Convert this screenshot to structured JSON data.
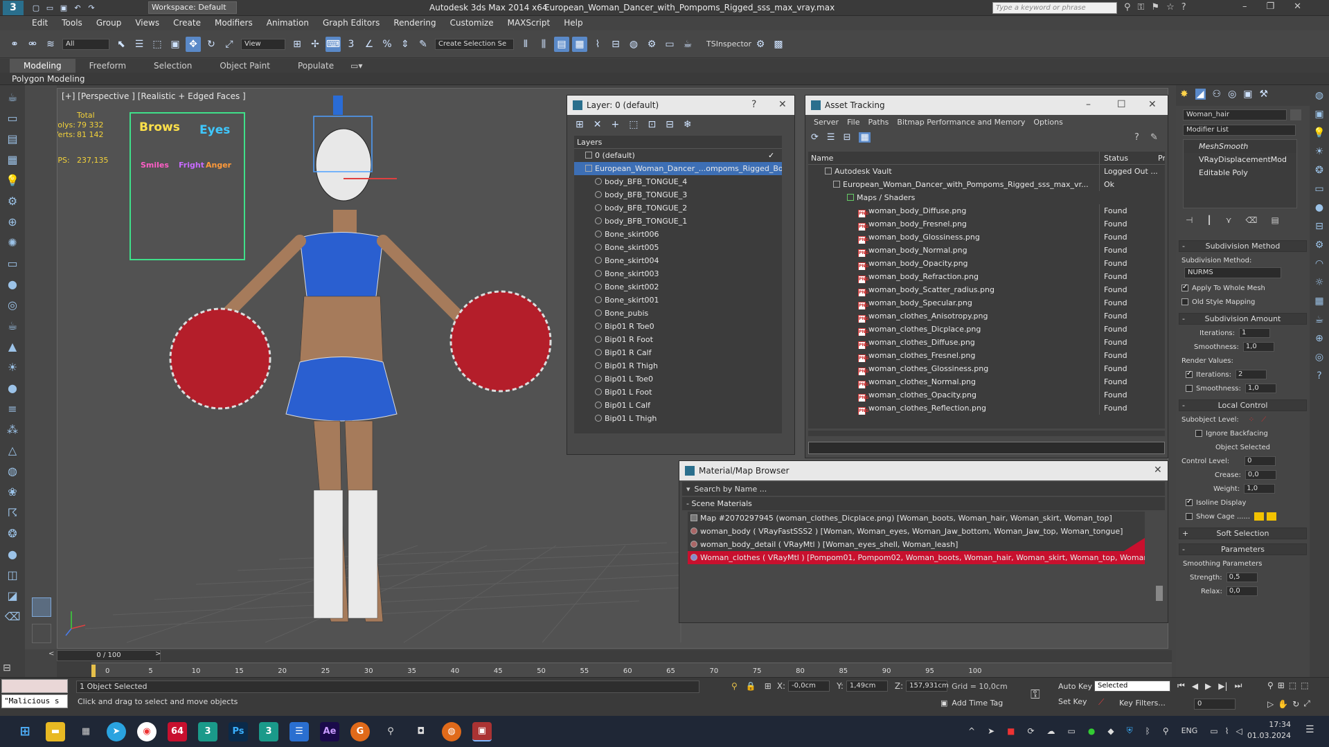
{
  "title_bar": {
    "workspace": "Workspace: Default",
    "app_title": "Autodesk 3ds Max  2014 x64",
    "file_name": "European_Woman_Dancer_with_Pompoms_Rigged_sss_max_vray.max",
    "search_placeholder": "Type a keyword or phrase"
  },
  "menu": [
    "Edit",
    "Tools",
    "Group",
    "Views",
    "Create",
    "Modifiers",
    "Animation",
    "Graph Editors",
    "Rendering",
    "Customize",
    "MAXScript",
    "Help"
  ],
  "toolbar": {
    "selection_filter": "All",
    "ref_coord": "View",
    "named_selection": "Create Selection Se",
    "tsinspector": "TSInspector"
  },
  "ribbon": {
    "tabs": [
      "Modeling",
      "Freeform",
      "Selection",
      "Object Paint",
      "Populate"
    ],
    "sub_label": "Polygon Modeling"
  },
  "viewport": {
    "label": "[+] [Perspective ] [Realistic + Edged Faces ]",
    "stats": {
      "total": "Total",
      "polys_label": "Polys:",
      "polys": "79 332",
      "verts_label": "Verts:",
      "verts": "81 142",
      "fps_label": "FPS:",
      "fps": "237,135"
    },
    "facial_board": {
      "brows": "Brows",
      "eyes": "Eyes",
      "smiles": "Smiles",
      "fright": "Fright",
      "anger": "Anger"
    }
  },
  "layer_window": {
    "title": "Layer: 0 (default)",
    "help": "?",
    "header": "Layers",
    "items": [
      "0 (default)",
      "European_Woman_Dancer_...ompoms_Rigged_Bor",
      "body_BFB_TONGUE_4",
      "body_BFB_TONGUE_3",
      "body_BFB_TONGUE_2",
      "body_BFB_TONGUE_1",
      "Bone_skirt006",
      "Bone_skirt005",
      "Bone_skirt004",
      "Bone_skirt003",
      "Bone_skirt002",
      "Bone_skirt001",
      "Bone_pubis",
      "Bip01 R Toe0",
      "Bip01 R Foot",
      "Bip01 R Calf",
      "Bip01 R Thigh",
      "Bip01 L Toe0",
      "Bip01 L Foot",
      "Bip01 L Calf",
      "Bip01 L Thigh"
    ]
  },
  "asset_tracking": {
    "title": "Asset Tracking",
    "menu": [
      "Server",
      "File",
      "Paths",
      "Bitmap Performance and Memory",
      "Options"
    ],
    "columns": [
      "Name",
      "Status",
      "Pro"
    ],
    "vault": {
      "name": "Autodesk Vault",
      "status": "Logged Out ..."
    },
    "scene": {
      "name": "European_Woman_Dancer_with_Pompoms_Rigged_sss_max_vr...",
      "status": "Ok"
    },
    "maps_label": "Maps / Shaders",
    "files": [
      {
        "name": "woman_body_Diffuse.png",
        "status": "Found"
      },
      {
        "name": "woman_body_Fresnel.png",
        "status": "Found"
      },
      {
        "name": "woman_body_Glossiness.png",
        "status": "Found"
      },
      {
        "name": "woman_body_Normal.png",
        "status": "Found"
      },
      {
        "name": "woman_body_Opacity.png",
        "status": "Found"
      },
      {
        "name": "woman_body_Refraction.png",
        "status": "Found"
      },
      {
        "name": "woman_body_Scatter_radius.png",
        "status": "Found"
      },
      {
        "name": "woman_body_Specular.png",
        "status": "Found"
      },
      {
        "name": "woman_clothes_Anisotropy.png",
        "status": "Found"
      },
      {
        "name": "woman_clothes_Dicplace.png",
        "status": "Found"
      },
      {
        "name": "woman_clothes_Diffuse.png",
        "status": "Found"
      },
      {
        "name": "woman_clothes_Fresnel.png",
        "status": "Found"
      },
      {
        "name": "woman_clothes_Glossiness.png",
        "status": "Found"
      },
      {
        "name": "woman_clothes_Normal.png",
        "status": "Found"
      },
      {
        "name": "woman_clothes_Opacity.png",
        "status": "Found"
      },
      {
        "name": "woman_clothes_Reflection.png",
        "status": "Found"
      }
    ]
  },
  "material_browser": {
    "title": "Material/Map Browser",
    "search_placeholder": "Search by Name ...",
    "section": "- Scene Materials",
    "items": [
      "Map #2070297945 (woman_clothes_Dicplace.png) [Woman_boots, Woman_hair, Woman_skirt, Woman_top]",
      "woman_body  ( VRayFastSSS2 ) [Woman, Woman_eyes, Woman_Jaw_bottom, Woman_Jaw_top, Woman_tongue]",
      "woman_body_detail  ( VRayMtl ) [Woman_eyes_shell, Woman_leash]",
      "Woman_clothes  ( VRayMtl ) [Pompom01, Pompom02, Woman_boots, Woman_hair, Woman_skirt, Woman_top, Woman_unde..."
    ]
  },
  "command_panel": {
    "object_name": "Woman_hair",
    "modifier_list": "Modifier List",
    "stack": [
      "MeshSmooth",
      "VRayDisplacementMod",
      "Editable Poly"
    ],
    "subdivision_method_title": "Subdivision Method",
    "subdivision_method_label": "Subdivision Method:",
    "subdivision_method_value": "NURMS",
    "apply_whole_mesh": "Apply To Whole Mesh",
    "old_style_mapping": "Old Style Mapping",
    "subdivision_amount_title": "Subdivision Amount",
    "iterations_label": "Iterations:",
    "iterations": "1",
    "smoothness_label": "Smoothness:",
    "smoothness": "1,0",
    "render_values": "Render Values:",
    "render_iterations": "2",
    "render_smoothness": "1,0",
    "local_control_title": "Local Control",
    "subobject_level": "Subobject Level:",
    "ignore_backfacing": "Ignore Backfacing",
    "object_selected": "Object Selected",
    "control_level_label": "Control Level:",
    "control_level": "0",
    "crease_label": "Crease:",
    "crease": "0,0",
    "weight_label": "Weight:",
    "weight": "1,0",
    "isoline_display": "Isoline Display",
    "show_cage": "Show Cage ......",
    "soft_selection_title": "Soft Selection",
    "parameters_title": "Parameters",
    "smoothing_parameters": "Smoothing Parameters",
    "strength_label": "Strength:",
    "strength": "0,5",
    "relax_label": "Relax:",
    "relax": "0,0"
  },
  "timeline": {
    "frame": "0 / 100",
    "ticks": [
      "0",
      "5",
      "10",
      "15",
      "20",
      "25",
      "30",
      "35",
      "40",
      "45",
      "50",
      "55",
      "60",
      "65",
      "70",
      "75",
      "80",
      "85",
      "90",
      "95",
      "100"
    ]
  },
  "status": {
    "maxscript": "\"Malicious s",
    "selected": "1 Object Selected",
    "prompt": "Click and drag to select and move objects",
    "x_label": "X:",
    "x": "-0,0cm",
    "y_label": "Y:",
    "y": "1,49cm",
    "z_label": "Z:",
    "z": "157,931cm",
    "grid": "Grid = 10,0cm",
    "add_time_tag": "Add Time Tag",
    "auto_key": "Auto Key",
    "set_key": "Set Key",
    "selected_dropdown": "Selected",
    "key_filters": "Key Filters...",
    "frame_field": "0"
  },
  "taskbar": {
    "lang": "ENG",
    "time": "17:34",
    "date": "01.03.2024",
    "apps": [
      "64",
      "Ps",
      "Ae"
    ]
  },
  "colors": {
    "accent": "#5a89c8",
    "found": "#e8e8e8",
    "selected_row": "#3d6fb5",
    "highlight_red": "#c8102e"
  }
}
